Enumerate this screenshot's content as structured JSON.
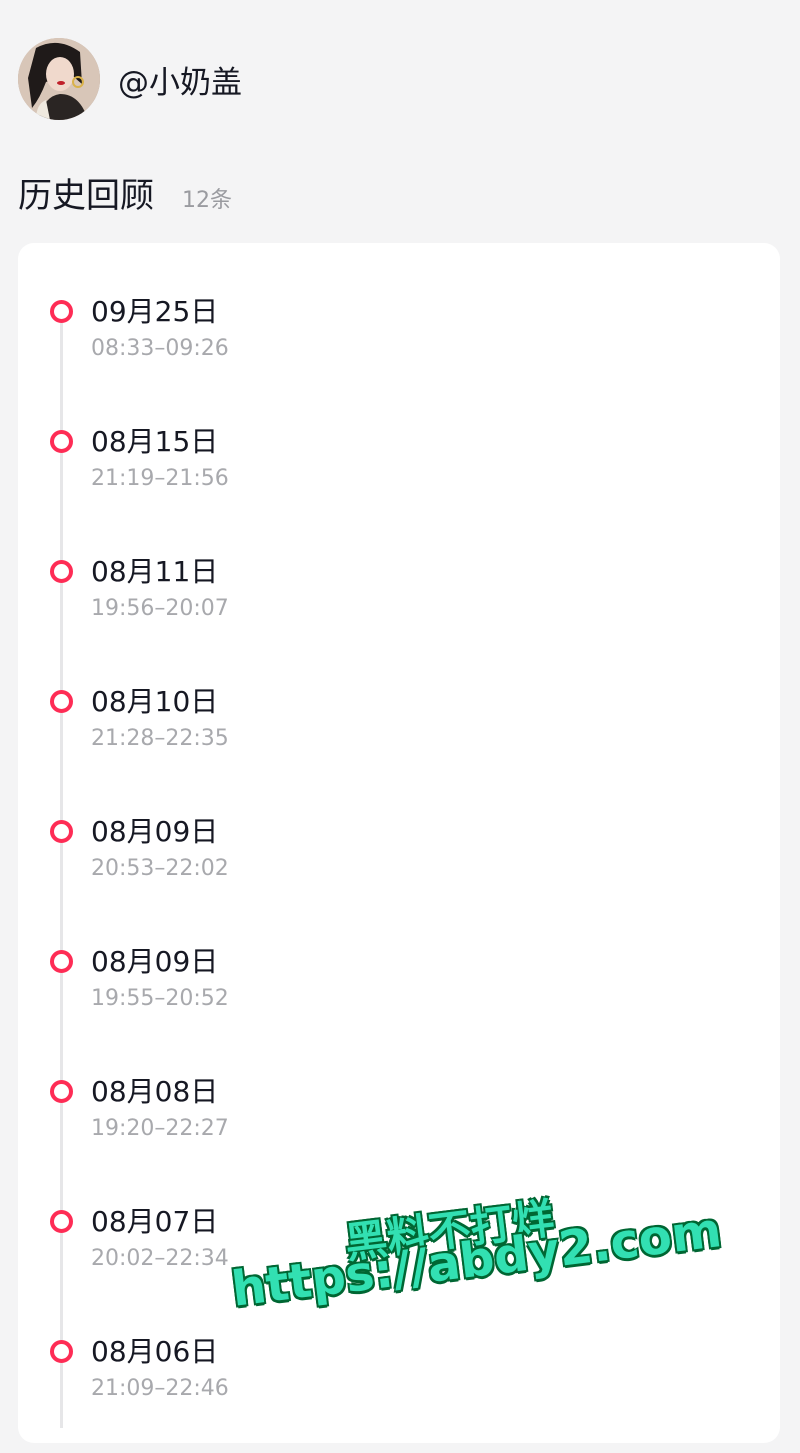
{
  "profile": {
    "avatar_icon": "user-avatar-photo",
    "username": "@小奶盖"
  },
  "section": {
    "title": "历史回顾",
    "count": "12条"
  },
  "history": [
    {
      "date": "09月25日",
      "time": "08:33–09:26"
    },
    {
      "date": "08月15日",
      "time": "21:19–21:56"
    },
    {
      "date": "08月11日",
      "time": "19:56–20:07"
    },
    {
      "date": "08月10日",
      "time": "21:28–22:35"
    },
    {
      "date": "08月09日",
      "time": "20:53–22:02"
    },
    {
      "date": "08月09日",
      "time": "19:55–20:52"
    },
    {
      "date": "08月08日",
      "time": "19:20–22:27"
    },
    {
      "date": "08月07日",
      "time": "20:02–22:34"
    },
    {
      "date": "08月06日",
      "time": "21:09–22:46"
    }
  ],
  "watermark": {
    "line1": "黑料不打烊",
    "line2": "https://abdy2.com"
  },
  "colors": {
    "accent": "#fe2c55",
    "background": "#f4f4f5",
    "watermark": "#32e0b2"
  }
}
